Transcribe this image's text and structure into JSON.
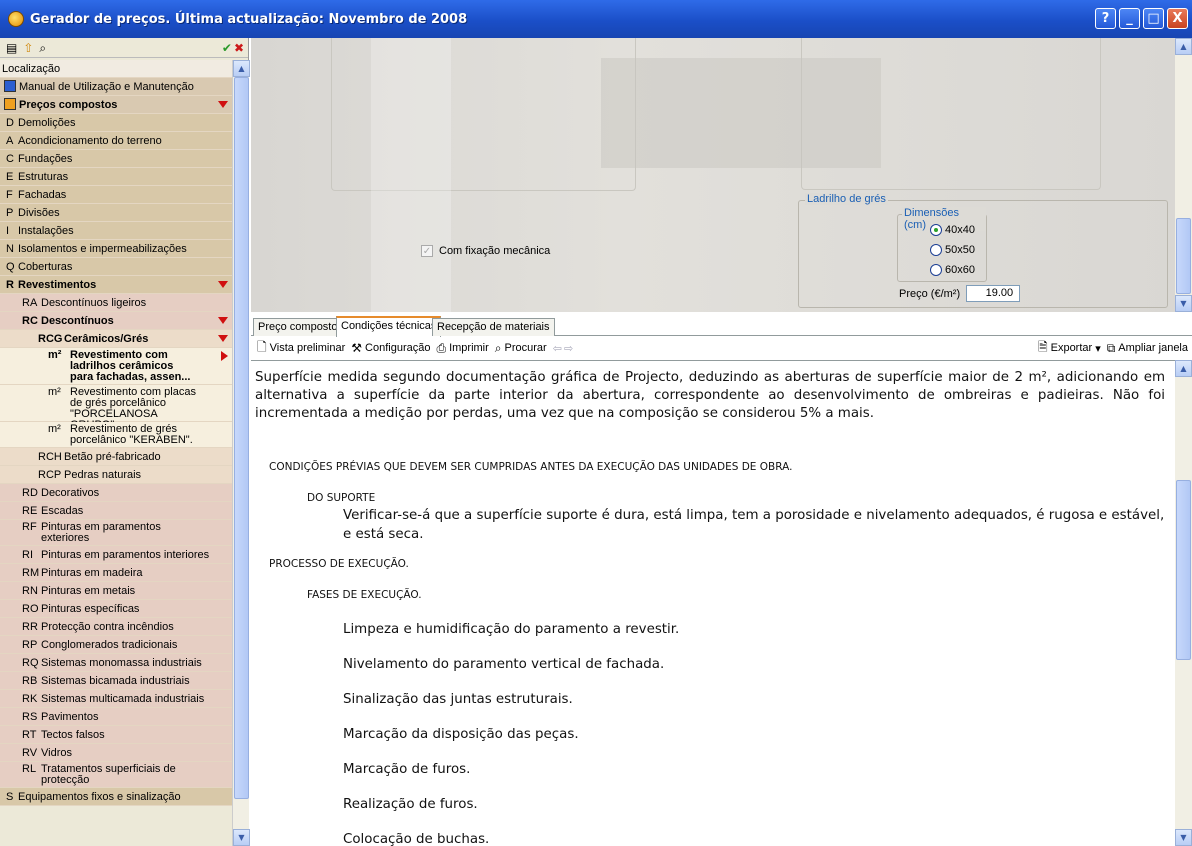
{
  "window": {
    "title": "Gerador de preços. Última actualização: Novembro de 2008",
    "buttons": [
      "?",
      "_",
      "□",
      "X"
    ]
  },
  "left": {
    "toolbar_icons": [
      "view-icon",
      "up-icon",
      "find-icon"
    ],
    "accept": "✔",
    "reject": "✖",
    "tree": [
      {
        "code": "",
        "label": "Localização",
        "bold": false,
        "indent": 0,
        "bg": "#f1ebe1"
      },
      {
        "code": "",
        "label": "Manual de Utilização e Manutenção",
        "bold": false,
        "indent": 0,
        "bg": "#d9c9b1",
        "icon": "manual-icon"
      },
      {
        "code": "",
        "label": "Preços compostos",
        "bold": true,
        "indent": 0,
        "bg": "#d9c9b1",
        "icon": "prices-icon",
        "expanded": true
      },
      {
        "code": "D",
        "label": "Demolições",
        "indent": 1,
        "bg": "#d8c8a8"
      },
      {
        "code": "A",
        "label": "Acondicionamento do terreno",
        "indent": 1,
        "bg": "#d8c8a8"
      },
      {
        "code": "C",
        "label": "Fundações",
        "indent": 1,
        "bg": "#d8c8a8"
      },
      {
        "code": "E",
        "label": "Estruturas",
        "indent": 1,
        "bg": "#d8c8a8"
      },
      {
        "code": "F",
        "label": "Fachadas",
        "indent": 1,
        "bg": "#d8c8a8"
      },
      {
        "code": "P",
        "label": "Divisões",
        "indent": 1,
        "bg": "#d8c8a8"
      },
      {
        "code": "I",
        "label": "Instalações",
        "indent": 1,
        "bg": "#d8c8a8"
      },
      {
        "code": "N",
        "label": "Isolamentos e impermeabilizações",
        "indent": 1,
        "bg": "#d8c8a8"
      },
      {
        "code": "Q",
        "label": "Coberturas",
        "indent": 1,
        "bg": "#d8c8a8"
      },
      {
        "code": "R",
        "label": "Revestimentos",
        "bold": true,
        "indent": 1,
        "bg": "#d8c8a8",
        "expanded": true
      },
      {
        "code": "RA",
        "label": "Descontínuos ligeiros",
        "indent": 2,
        "bg": "#e6cec3"
      },
      {
        "code": "RC",
        "label": "Descontínuos",
        "bold": true,
        "indent": 2,
        "bg": "#e6cec3",
        "expanded": true
      },
      {
        "code": "RCG",
        "label": "Cerâmicos/Grés",
        "bold": true,
        "indent": 3,
        "bg": "#ecdcc9",
        "expanded": true
      },
      {
        "code": "m²",
        "label": "Revestimento com ladrilhos cerâmicos para fachadas, assen...",
        "bold": true,
        "indent": 4,
        "bg": "#f6efde",
        "lines": 3,
        "selected": true
      },
      {
        "code": "m²",
        "label": "Revestimento com placas de grés porcelânico \"PORCELANOSA GRUPO\".",
        "indent": 4,
        "bg": "#f6efde",
        "lines": 3
      },
      {
        "code": "m²",
        "label": "Revestimento de grés porcelânico \"KERABEN\".",
        "indent": 4,
        "bg": "#f6efde",
        "lines": 2
      },
      {
        "code": "RCH",
        "label": "Betão pré-fabricado",
        "indent": 3,
        "bg": "#ecdcc9"
      },
      {
        "code": "RCP",
        "label": "Pedras naturais",
        "indent": 3,
        "bg": "#ecdcc9"
      },
      {
        "code": "RD",
        "label": "Decorativos",
        "indent": 2,
        "bg": "#e6cec3"
      },
      {
        "code": "RE",
        "label": "Escadas",
        "indent": 2,
        "bg": "#e6cec3"
      },
      {
        "code": "RF",
        "label": "Pinturas em paramentos exteriores",
        "indent": 2,
        "bg": "#e6cec3",
        "lines": 2
      },
      {
        "code": "RI",
        "label": "Pinturas em paramentos interiores",
        "indent": 2,
        "bg": "#e6cec3"
      },
      {
        "code": "RM",
        "label": "Pinturas em madeira",
        "indent": 2,
        "bg": "#e6cec3"
      },
      {
        "code": "RN",
        "label": "Pinturas em metais",
        "indent": 2,
        "bg": "#e6cec3"
      },
      {
        "code": "RO",
        "label": "Pinturas específicas",
        "indent": 2,
        "bg": "#e6cec3"
      },
      {
        "code": "RR",
        "label": "Protecção contra incêndios",
        "indent": 2,
        "bg": "#e6cec3"
      },
      {
        "code": "RP",
        "label": "Conglomerados tradicionais",
        "indent": 2,
        "bg": "#e6cec3"
      },
      {
        "code": "RQ",
        "label": "Sistemas monomassa industriais",
        "indent": 2,
        "bg": "#e6cec3"
      },
      {
        "code": "RB",
        "label": "Sistemas bicamada industriais",
        "indent": 2,
        "bg": "#e6cec3"
      },
      {
        "code": "RK",
        "label": "Sistemas multicamada industriais",
        "indent": 2,
        "bg": "#e6cec3"
      },
      {
        "code": "RS",
        "label": "Pavimentos",
        "indent": 2,
        "bg": "#e6cec3"
      },
      {
        "code": "RT",
        "label": "Tectos falsos",
        "indent": 2,
        "bg": "#e6cec3"
      },
      {
        "code": "RV",
        "label": "Vidros",
        "indent": 2,
        "bg": "#e6cec3"
      },
      {
        "code": "RL",
        "label": "Tratamentos superficiais de protecção",
        "indent": 2,
        "bg": "#e6cec3",
        "lines": 2
      },
      {
        "code": "S",
        "label": "Equipamentos fixos e sinalização",
        "indent": 1,
        "bg": "#d8c8a8"
      }
    ]
  },
  "options": {
    "checkbox_label": "Com fixação mecânica",
    "group_title": "Ladrilho de grés",
    "dim_title": "Dimensões (cm)",
    "dims": [
      "40x40",
      "50x50",
      "60x60"
    ],
    "selected_dim": "40x40",
    "price_label": "Preço (€/m²)",
    "price_value": "19.00"
  },
  "tabs": [
    "Preço composto",
    "Condições técnicas",
    "Recepção de materiais"
  ],
  "active_tab": "Condições técnicas",
  "toolbar": {
    "preview": "Vista preliminar",
    "config": "Configuração",
    "print": "Imprimir",
    "search": "Procurar",
    "export": "Exportar",
    "zoom": "Ampliar janela"
  },
  "doc": {
    "intro": "Superfície medida segundo documentação gráfica de Projecto, deduzindo as aberturas de superfície maior de 2 m², adicionando em alternativa a superfície da parte interior da abertura, correspondente ao desenvolvimento de ombreiras e padieiras. Não foi incrementada a medição por perdas, uma vez que na composição se considerou 5% a mais.",
    "h1": "CONDIÇÕES PRÉVIAS QUE DEVEM SER CUMPRIDAS ANTES DA EXECUÇÃO DAS UNIDADES DE OBRA.",
    "h1_sub": "DO SUPORTE",
    "h1_text": "Verificar-se-á que a superfície suporte é dura, está limpa, tem a porosidade e nivelamento adequados, é rugosa e estável, e está seca.",
    "h2": "PROCESSO DE EXECUÇÃO.",
    "h2_sub": "FASES DE EXECUÇÃO.",
    "steps": [
      "Limpeza e humidificação do paramento a revestir.",
      "Nivelamento do paramento vertical de fachada.",
      "Sinalização das juntas estruturais.",
      "Marcação da disposição das peças.",
      "Marcação de furos.",
      "Realização de furos.",
      "Colocação de buchas."
    ]
  }
}
